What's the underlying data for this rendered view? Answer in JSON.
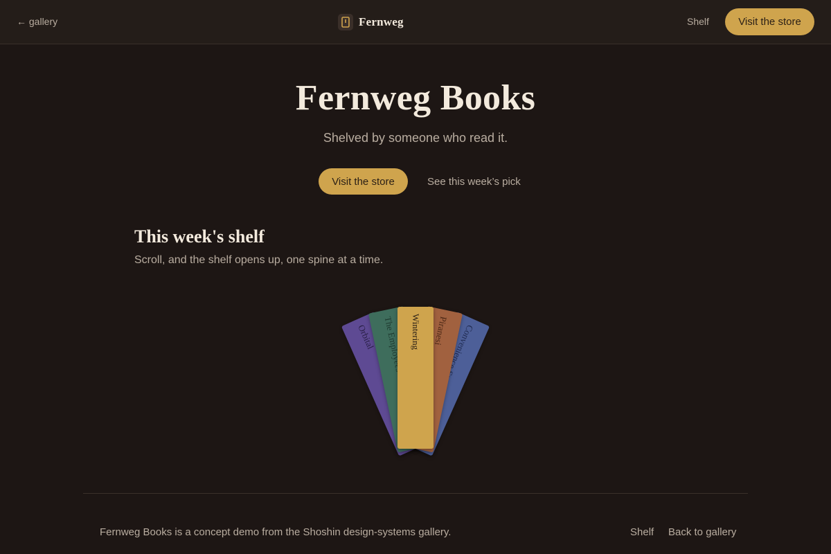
{
  "topbar": {
    "back_label": "← gallery",
    "brand_name": "Fernweg",
    "brand_icon": "book-spine-icon",
    "nav_shelf": "Shelf",
    "nav_cta": "Visit the store"
  },
  "hero": {
    "title": "Fernweg Books",
    "subtitle": "Shelved by someone who read it.",
    "cta": "Visit the store",
    "secondary_link": "See this week’s pick"
  },
  "shelf": {
    "title": "This week's shelf",
    "subtitle": "Scroll, and the shelf opens up, one spine at a time.",
    "books": [
      {
        "title": "Orbital",
        "color": "#5e4a93",
        "text_color": "#2a2048"
      },
      {
        "title": "The Employees",
        "color": "#3e6d5c",
        "text_color": "#1f3a30"
      },
      {
        "title": "Wintering",
        "color": "#cfa44d",
        "text_color": "#2a1f16"
      },
      {
        "title": "Piranesi",
        "color": "#a1613f",
        "text_color": "#4a2715"
      },
      {
        "title": "Convenience Store Woman",
        "color": "#4d5f98",
        "text_color": "#1f2a4f"
      }
    ]
  },
  "colors": {
    "background": "#1d1614",
    "accent": "#cfa44d",
    "text_primary": "#f3eadd",
    "text_muted": "#b9ada0"
  },
  "footer": {
    "text": "Fernweg Books is a concept demo from the Shoshin design-systems gallery.",
    "shelf_link": "Shelf",
    "gallery_link": "Back to gallery"
  }
}
